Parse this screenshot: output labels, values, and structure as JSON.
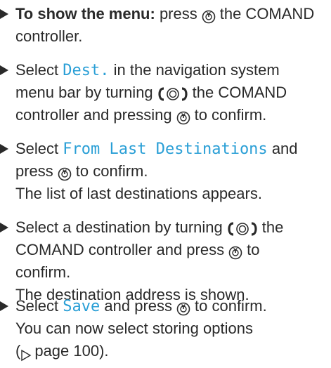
{
  "step1": {
    "bold": "To show the menu:",
    "a": "press",
    "b": "the COMAND",
    "line2": "controller."
  },
  "step2": {
    "l1a": "Select",
    "l1code": "Dest.",
    "l1b": "in the navigation system",
    "l2a": "menu bar by turning",
    "l2b": "the COMAND",
    "l3a": "controller and pressing",
    "l3b": "to confirm."
  },
  "step3": {
    "l1a": "Select",
    "l1code": "From Last Destinations",
    "l1b": "and",
    "l2a": "press",
    "l2b": "to confirm.",
    "l3": "The list of last destinations appears."
  },
  "step4": {
    "l1a": "Select a destination by turning",
    "l1b": "the",
    "l2a": "COMAND controller and press",
    "l2b": "to",
    "l3": "confirm.",
    "l4": "The destination address is shown."
  },
  "step5": {
    "l1a": "Select",
    "l1code": "Save",
    "l1b": "and press",
    "l1c": "to confirm.",
    "l2": "You can now select storing options",
    "l3a": "(",
    "l3b": "page 100)."
  },
  "icons": {
    "press": "press-controller-icon",
    "turn": "turn-controller-icon",
    "pageref": "page-reference-triangle-icon"
  },
  "colors": {
    "text": "#2a2a2a",
    "code": "#2a9fd6"
  }
}
